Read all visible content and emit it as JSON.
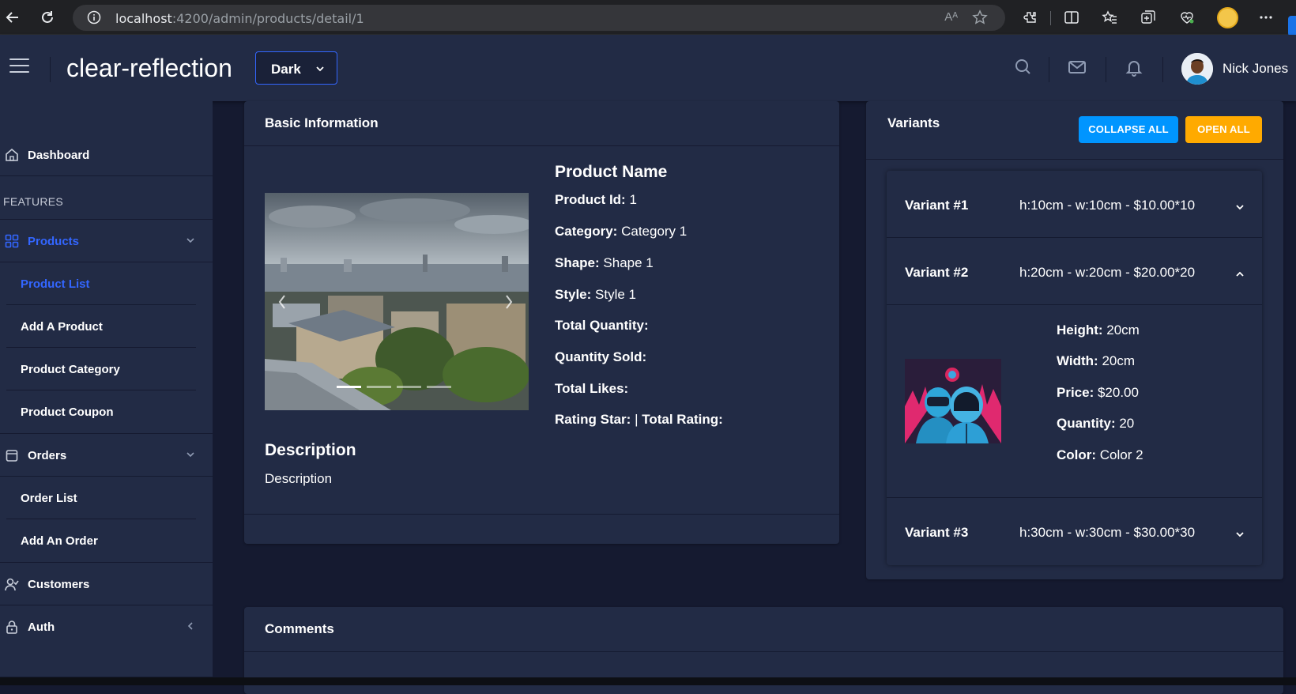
{
  "browser": {
    "url_host": "localhost",
    "url_path": ":4200/admin/products/detail/1",
    "read_aloud": "Aᴬ"
  },
  "header": {
    "app_title": "clear-reflection",
    "theme_value": "Dark",
    "user_name": "Nick Jones"
  },
  "sidebar": {
    "dashboard": "Dashboard",
    "group_label": "FEATURES",
    "products": "Products",
    "product_list": "Product List",
    "add_product": "Add A Product",
    "product_category": "Product Category",
    "product_coupon": "Product Coupon",
    "orders": "Orders",
    "order_list": "Order List",
    "add_order": "Add An Order",
    "customers": "Customers",
    "auth": "Auth"
  },
  "basic": {
    "title": "Basic Information",
    "product_name": "Product Name",
    "fields": [
      {
        "label": "Product Id:",
        "value": " 1"
      },
      {
        "label": "Category:",
        "value": " Category 1"
      },
      {
        "label": "Shape:",
        "value": " Shape 1"
      },
      {
        "label": "Style:",
        "value": " Style 1"
      },
      {
        "label": "Total Quantity:",
        "value": ""
      },
      {
        "label": "Quantity Sold:",
        "value": ""
      },
      {
        "label": "Total Likes:",
        "value": ""
      },
      {
        "label": "Rating Star:",
        "value": " | "
      },
      {
        "label": "Total Rating:",
        "value": ""
      }
    ],
    "description_title": "Description",
    "description_text": "Description",
    "carousel_slide": 1,
    "carousel_count": 4
  },
  "variants": {
    "title": "Variants",
    "collapse_all": "COLLAPSE ALL",
    "open_all": "OPEN ALL",
    "items": [
      {
        "name": "Variant #1",
        "summary": "h:10cm - w:10cm - $10.00*10",
        "expanded": false
      },
      {
        "name": "Variant #2",
        "summary": "h:20cm - w:20cm - $20.00*20",
        "expanded": true
      },
      {
        "name": "Variant #3",
        "summary": "h:30cm - w:30cm - $30.00*30",
        "expanded": false
      }
    ],
    "detail": [
      {
        "label": "Height:",
        "value": " 20cm"
      },
      {
        "label": "Width:",
        "value": " 20cm"
      },
      {
        "label": "Price:",
        "value": " $20.00"
      },
      {
        "label": "Quantity:",
        "value": " 20"
      },
      {
        "label": "Color:",
        "value": " Color 2"
      }
    ]
  },
  "comments": {
    "title": "Comments"
  },
  "colors": {
    "background": "#151a30",
    "card": "#222b45",
    "primary": "#3366ff",
    "info": "#0095ff",
    "warning": "#ffaa00"
  }
}
